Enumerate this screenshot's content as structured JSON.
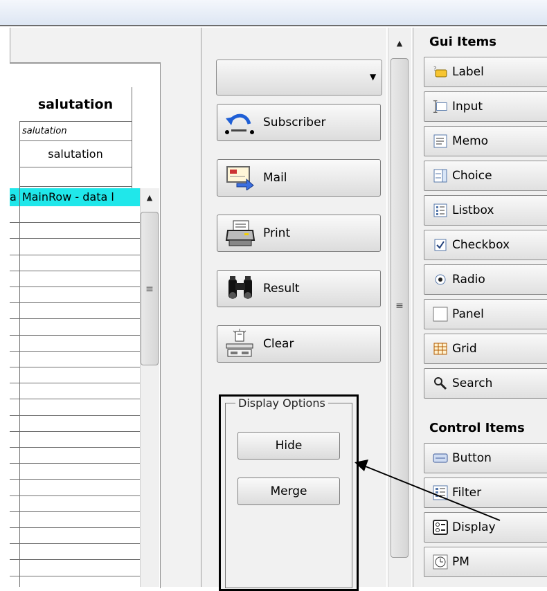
{
  "grid": {
    "header": "salutation",
    "sub_italic": "salutation",
    "sub_value": "salutation",
    "row_prefix": "a",
    "row_text": "MainRow - data l"
  },
  "middle": {
    "buttons": [
      {
        "label": "Subscriber",
        "icon": "subscriber-icon"
      },
      {
        "label": "Mail",
        "icon": "mail-icon"
      },
      {
        "label": "Print",
        "icon": "printer-icon"
      },
      {
        "label": "Result",
        "icon": "binoculars-icon"
      },
      {
        "label": "Clear",
        "icon": "clear-icon"
      }
    ],
    "group_title": "Display Options",
    "hide_label": "Hide",
    "merge_label": "Merge"
  },
  "palette": {
    "gui_title": "Gui Items",
    "gui_items": [
      "Label",
      "Input",
      "Memo",
      "Choice",
      "Listbox",
      "Checkbox",
      "Radio",
      "Panel",
      "Grid",
      "Search"
    ],
    "control_title": "Control Items",
    "control_items": [
      "Button",
      "Filter",
      "Display",
      "PM"
    ]
  },
  "colors": {
    "selected_row": "#20e7ea",
    "annotation": "#000000"
  }
}
